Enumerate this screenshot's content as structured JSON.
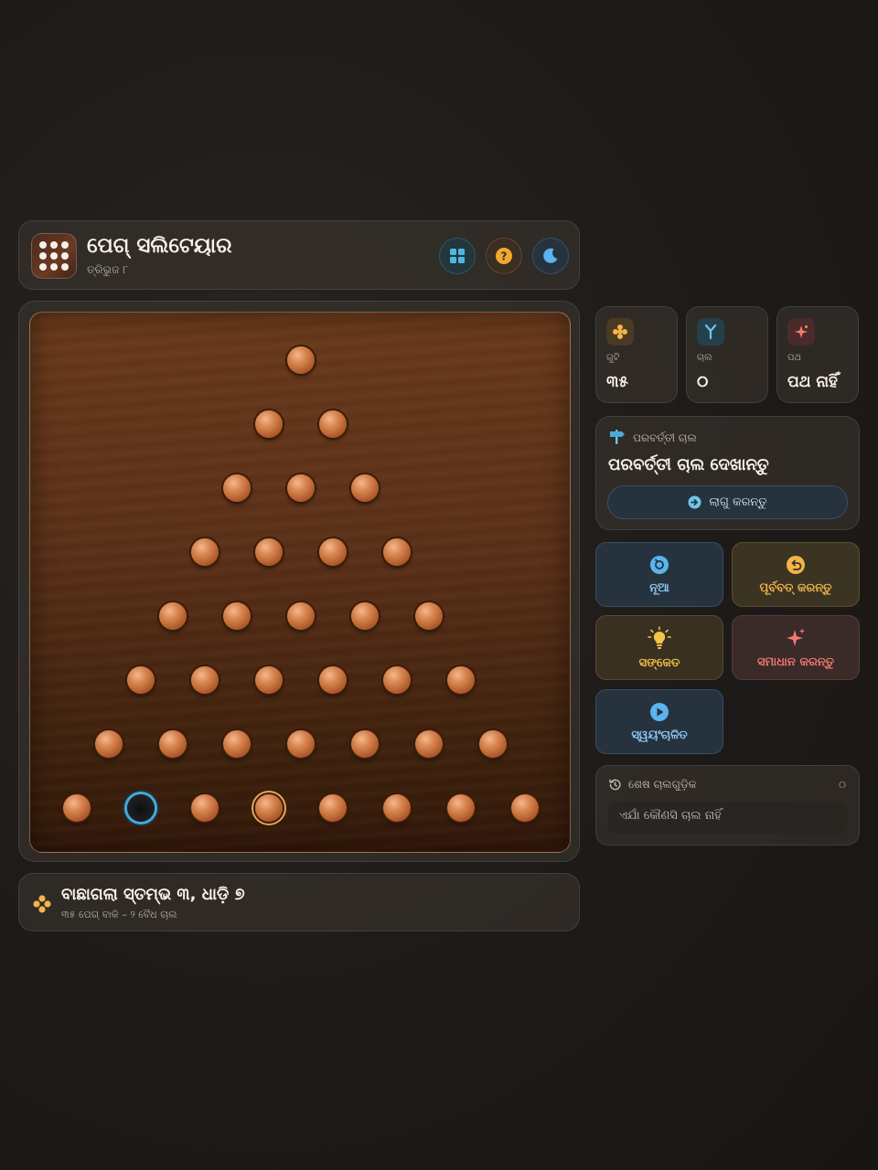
{
  "header": {
    "title": "ପେଗ୍ ସଲିଟେୟାର",
    "subtitle": "ତ୍ରିଭୁଜ ୮",
    "icons": [
      "grid-icon",
      "help-icon",
      "moon-icon"
    ]
  },
  "board": {
    "shape": "triangle",
    "rows": 8,
    "empty_hole": {
      "row": 7,
      "col": 1
    },
    "selected_peg": {
      "row": 7,
      "col": 3
    }
  },
  "status": {
    "title": "ବାଛାଗଲା ସ୍ତମ୍ଭ ୩, ଧାଡ଼ି ୭",
    "subtitle": "୩୫ ପେଗ୍ ବାକି – ୨ ବୈଧ ଚାଲ"
  },
  "stats": {
    "pegs": {
      "label": "ଗୁଟି",
      "value": "୩୫"
    },
    "moves": {
      "label": "ଚାଲ",
      "value": "୦"
    },
    "path": {
      "label": "ପଥ",
      "value": "ପଥ ନାହିଁ"
    }
  },
  "next_move": {
    "label": "ପରବର୍ତ୍ତୀ ଚାଲ",
    "title": "ପରବର୍ତ୍ତୀ ଚାଲ ଦେଖାନ୍ତୁ",
    "apply_label": "ଲାଗୁ କରନ୍ତୁ"
  },
  "actions": {
    "new": "ନୂଆ",
    "undo": "ପୂର୍ବବତ୍ କରନ୍ତୁ",
    "hint": "ସଙ୍କେତ",
    "solve": "ସମାଧାନ କରନ୍ତୁ",
    "auto": "ସ୍ୱୟଂଚାଳିତ"
  },
  "history": {
    "label": "ଶେଷ ଚାଲଗୁଡ଼ିକ",
    "count": "୦",
    "empty": "ଏଯାଁ କୌଣସି ଚାଲ ନାହିଁ"
  },
  "colors": {
    "accent_blue": "#4aa9d6",
    "accent_orange": "#e8a456",
    "solve_red": "#f07a72"
  }
}
